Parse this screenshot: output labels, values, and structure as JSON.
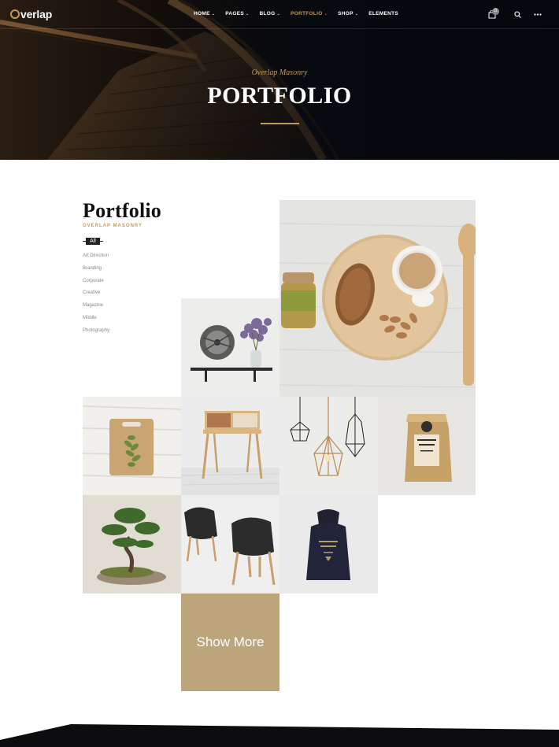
{
  "nav": {
    "logo": "verlap",
    "menu": [
      {
        "label": "HOME",
        "caret": "⌄",
        "active": false
      },
      {
        "label": "PAGES",
        "caret": "⌄",
        "active": false
      },
      {
        "label": "BLOG",
        "caret": "⌄",
        "active": false
      },
      {
        "label": "PORTFOLIO",
        "caret": "⌄",
        "active": true
      },
      {
        "label": "SHOP",
        "caret": "⌄",
        "active": false
      },
      {
        "label": "ELEMENTS",
        "caret": "",
        "active": false
      }
    ],
    "cart_count": "0",
    "icons": [
      "cart-icon",
      "search-icon",
      "more-icon"
    ]
  },
  "hero": {
    "subtitle": "Overlap Masonry",
    "title": "PORTFOLIO"
  },
  "sidebar": {
    "title": "Portfolio",
    "subtitle": "OVERLAP MASONRY",
    "filter_all": "All",
    "filters": [
      "Art Direction",
      "Branding",
      "Corporate",
      "Creative",
      "Magazine",
      "Mobile",
      "Photography"
    ]
  },
  "grid": {
    "tiles": [
      {
        "name": "breakfast-board",
        "image": "wooden board with bread, coffee cup, almonds and jar"
      },
      {
        "name": "clock-shelf",
        "image": "wall shelf with clock and lavender vase"
      },
      {
        "name": "cutting-board",
        "image": "cutting board with herbs on white wood"
      },
      {
        "name": "console-table",
        "image": "wooden console table"
      },
      {
        "name": "pendant-lamps",
        "image": "wire pendant lamps"
      },
      {
        "name": "coffee-bag",
        "image": "kraft coffee bag"
      },
      {
        "name": "bonsai",
        "image": "bonsai tree on rock"
      },
      {
        "name": "chairs",
        "image": "two black chairs"
      },
      {
        "name": "black-sack",
        "image": "black drawstring sack"
      }
    ],
    "show_more": "Show More"
  },
  "colors": {
    "accent": "#c29a5b",
    "show_more_bg": "#bca57a",
    "hero_dark": "#0c0f16",
    "text_dark": "#111111"
  }
}
